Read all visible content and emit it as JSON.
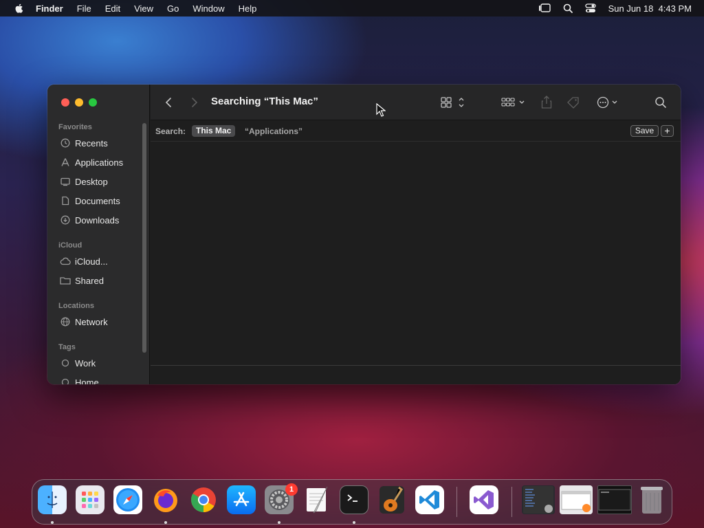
{
  "menubar": {
    "app_name": "Finder",
    "items": [
      "File",
      "Edit",
      "View",
      "Go",
      "Window",
      "Help"
    ],
    "clock": "Sun Jun 18  4:43 PM"
  },
  "window": {
    "title": "Searching “This Mac”",
    "sidebar": {
      "favorites_header": "Favorites",
      "favorites": [
        {
          "label": "Recents",
          "icon": "clock-icon"
        },
        {
          "label": "Applications",
          "icon": "applications-icon"
        },
        {
          "label": "Desktop",
          "icon": "desktop-icon"
        },
        {
          "label": "Documents",
          "icon": "document-icon"
        },
        {
          "label": "Downloads",
          "icon": "download-icon"
        }
      ],
      "icloud_header": "iCloud",
      "icloud": [
        {
          "label": "iCloud...",
          "icon": "cloud-icon"
        },
        {
          "label": "Shared",
          "icon": "shared-folder-icon"
        }
      ],
      "locations_header": "Locations",
      "locations": [
        {
          "label": "Network",
          "icon": "globe-icon"
        }
      ],
      "tags_header": "Tags",
      "tags": [
        {
          "label": "Work",
          "icon": "tag-circle-icon"
        },
        {
          "label": "Home",
          "icon": "tag-circle-icon"
        }
      ]
    },
    "search_bar": {
      "label": "Search:",
      "scope_active": "This Mac",
      "scope_other": "“Applications”",
      "save_label": "Save",
      "add_label": "+"
    }
  },
  "dock": {
    "apps": [
      {
        "name": "Finder",
        "icon": "finder-icon",
        "running": true
      },
      {
        "name": "Launchpad",
        "icon": "launchpad-icon",
        "running": false
      },
      {
        "name": "Safari",
        "icon": "safari-icon",
        "running": false
      },
      {
        "name": "Firefox",
        "icon": "firefox-icon",
        "running": true
      },
      {
        "name": "Chrome",
        "icon": "chrome-icon",
        "running": false
      },
      {
        "name": "App Store",
        "icon": "app-store-icon",
        "running": false
      },
      {
        "name": "System Preferences",
        "icon": "system-preferences-icon",
        "running": true,
        "badge": "1"
      },
      {
        "name": "TextEdit",
        "icon": "textedit-icon",
        "running": false
      },
      {
        "name": "Terminal",
        "icon": "terminal-icon",
        "running": true
      },
      {
        "name": "GarageBand",
        "icon": "garageband-icon",
        "running": false
      },
      {
        "name": "VS Code",
        "icon": "vscode-icon",
        "running": false
      },
      {
        "name": "Visual Studio",
        "icon": "visual-studio-icon",
        "running": false
      },
      {
        "name": "Recent Window 1",
        "icon": "window-thumbnail-icon",
        "running": false
      },
      {
        "name": "Recent Window 2",
        "icon": "window-thumbnail-icon",
        "running": false
      },
      {
        "name": "Recent Window 3",
        "icon": "window-thumbnail-icon",
        "running": false
      },
      {
        "name": "Trash",
        "icon": "trash-icon",
        "running": false
      }
    ]
  }
}
